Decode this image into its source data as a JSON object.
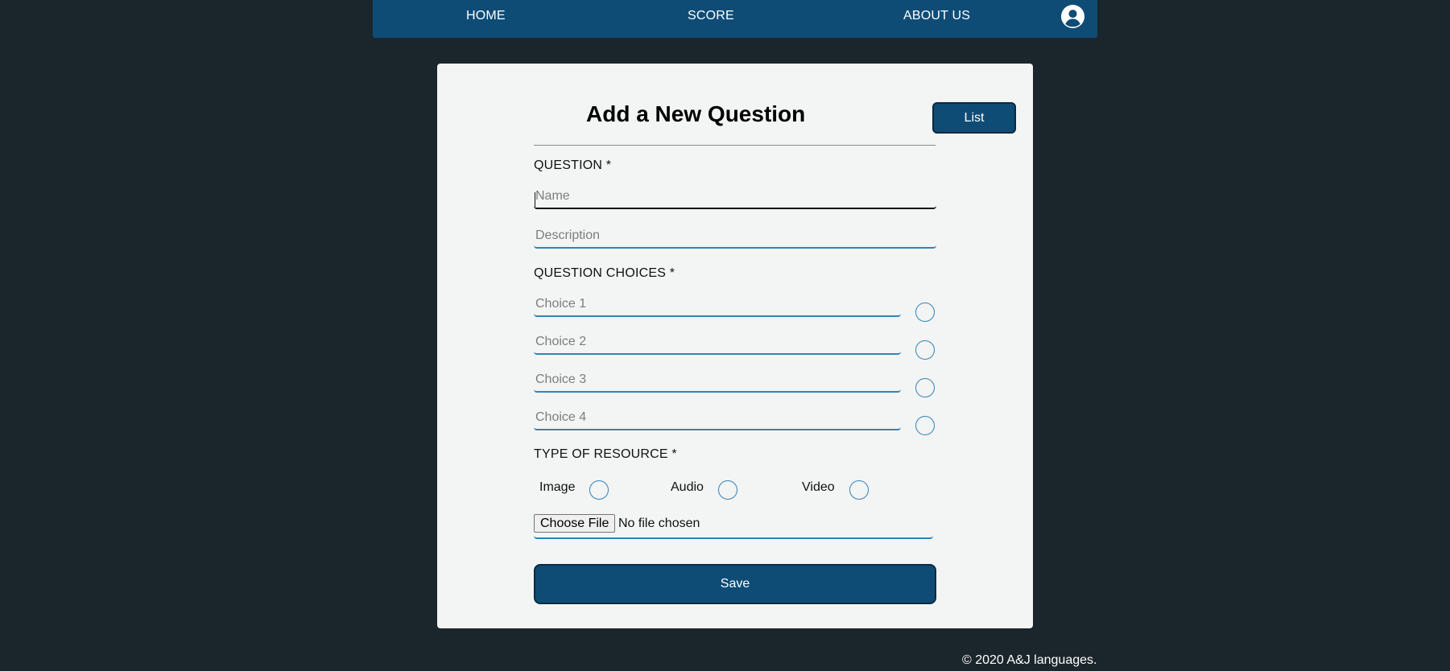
{
  "colors": {
    "background": "#1b262c",
    "primary": "#0f4c75",
    "accent": "#3282b8",
    "card": "#f3f4f4",
    "text_light": "#ffffff"
  },
  "nav": {
    "home": "HOME",
    "score": "SCORE",
    "about": "ABOUT US",
    "avatar_icon": "user-circle-icon"
  },
  "form": {
    "title": "Add a New Question",
    "list_button": "List",
    "question_label": "QUESTION *",
    "name_placeholder": "Name",
    "name_value": "",
    "description_placeholder": "Description",
    "description_value": "",
    "choices_label": "QUESTION CHOICES *",
    "choices": [
      {
        "placeholder": "Choice 1",
        "value": "",
        "correct": false
      },
      {
        "placeholder": "Choice 2",
        "value": "",
        "correct": false
      },
      {
        "placeholder": "Choice 3",
        "value": "",
        "correct": false
      },
      {
        "placeholder": "Choice 4",
        "value": "",
        "correct": false
      }
    ],
    "resource_label": "TYPE OF RESOURCE *",
    "resource_types": [
      {
        "label": "Image",
        "selected": false
      },
      {
        "label": "Audio",
        "selected": false
      },
      {
        "label": "Video",
        "selected": false
      }
    ],
    "file_button": "Choose File",
    "file_status": "No file chosen",
    "save_button": "Save"
  },
  "footer": {
    "text": "© 2020 A&J languages."
  }
}
